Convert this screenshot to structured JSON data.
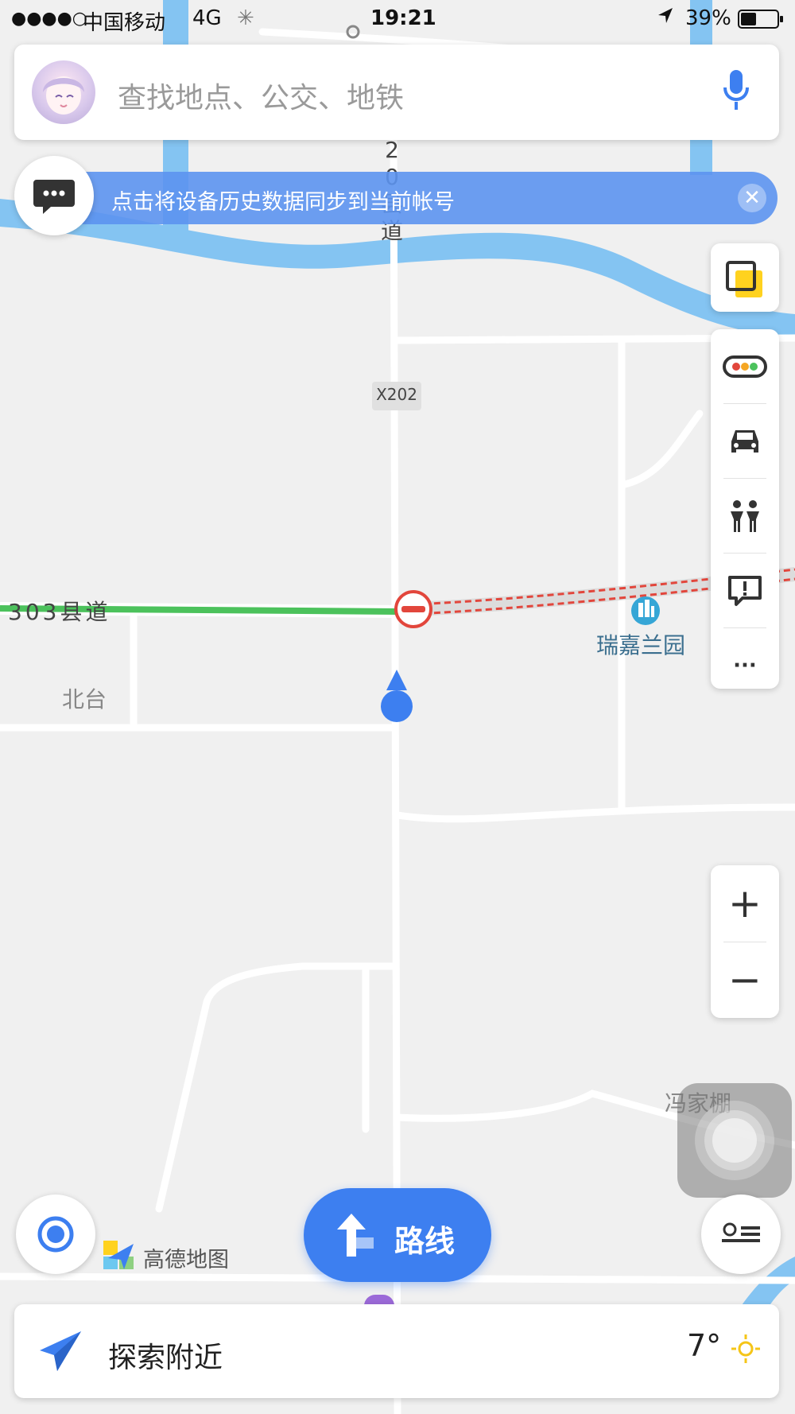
{
  "status_bar": {
    "signal": "●●●●○",
    "carrier": "中国移动",
    "network": "4G",
    "time": "19:21",
    "battery": "39%"
  },
  "search": {
    "placeholder": "查找地点、公交、地铁"
  },
  "sync_banner": {
    "text": "点击将设备历史数据同步到当前帐号",
    "close": "✕"
  },
  "map": {
    "road_vertical_label": "20县道",
    "road_shield": "X202",
    "road_horizontal_label": "303县道",
    "place_beitai": "北台",
    "poi_ruijia": "瑞嘉兰园",
    "place_fengjiapeng": "冯家棚",
    "logo_text": "高德地图"
  },
  "controls": {
    "zoom_in": "+",
    "zoom_out": "−",
    "more": "···"
  },
  "route_button": {
    "label": "路线"
  },
  "explore": {
    "label": "探索附近",
    "temperature": "7°"
  },
  "colors": {
    "accent": "#3d7ff0",
    "water": "#84c4f2",
    "route_green": "#4cc25c",
    "closure_red": "#e2463c"
  }
}
